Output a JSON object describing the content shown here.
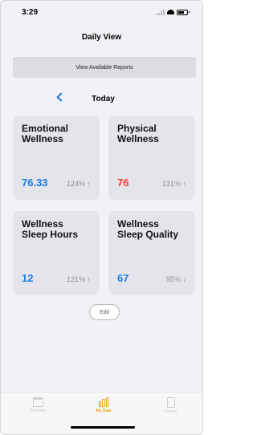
{
  "status_bar": {
    "time": "3:29"
  },
  "header": {
    "title": "Daily View"
  },
  "reports_button": {
    "label": "View Available Reports"
  },
  "date_nav": {
    "label": "Today"
  },
  "cards": [
    {
      "title": "Emotional Wellness",
      "value": "76.33",
      "change": "124% ↑",
      "value_color": "#1a7de8"
    },
    {
      "title": "Physical Wellness",
      "value": "76",
      "change": "131% ↑",
      "value_color": "#ff3b30"
    },
    {
      "title": "Wellness Sleep Hours",
      "value": "12",
      "change": "121% ↑",
      "value_color": "#1a7de8"
    },
    {
      "title": "Wellness Sleep Quality",
      "value": "67",
      "change": "95% ↓",
      "value_color": "#1a7de8"
    }
  ],
  "edit_button": {
    "label": "Edit"
  },
  "tab_bar": {
    "tabs": [
      {
        "label": "Schedule",
        "icon": "calendar-icon",
        "active": false
      },
      {
        "label": "My Data",
        "icon": "bar-chart-icon",
        "active": true
      },
      {
        "label": "Forms",
        "icon": "document-icon",
        "active": false
      }
    ]
  }
}
